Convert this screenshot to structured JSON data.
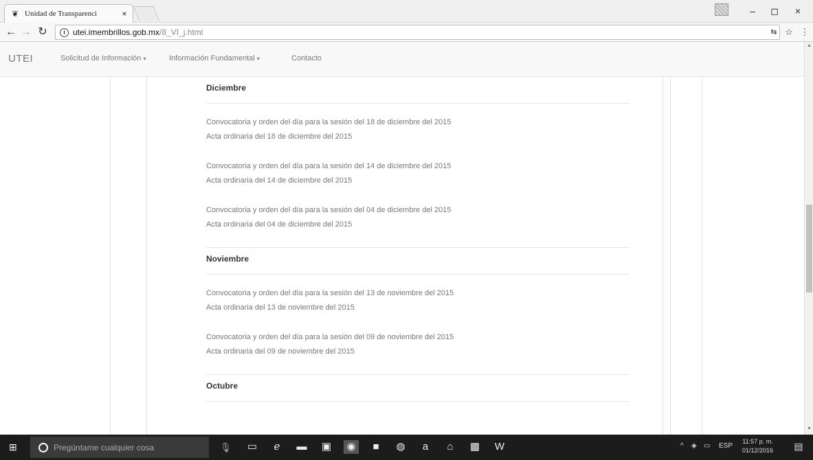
{
  "browser": {
    "tab_title": "Unidad de Transparenci",
    "tab_close": "×",
    "url_host": "utei.imembrillos.gob.mx",
    "url_path": "/8_VI_j.html",
    "window_min": "–",
    "window_max": "◻",
    "window_close": "×"
  },
  "navbar": {
    "brand": "UTEI",
    "links": [
      {
        "label": "Solicitud de Información",
        "has_caret": true
      },
      {
        "label": "Información Fundamental",
        "has_caret": true
      },
      {
        "label": "Contacto",
        "has_caret": false
      }
    ],
    "caret": "▾"
  },
  "sections": [
    {
      "month": "Diciembre",
      "entries": [
        {
          "convocatoria": "Convocatoria y orden del día para la sesión del 18 de diciembre del 2015",
          "acta": "Acta ordinaria del 18 de diciembre del 2015"
        },
        {
          "convocatoria": "Convocatoria y orden del día para la sesión del 14 de diciembre del 2015",
          "acta": "Acta ordinaria del 14 de diciembre del 2015"
        },
        {
          "convocatoria": "Convocatoria y orden del día para la sesión del 04 de diciembre del 2015",
          "acta": "Acta ordinaria del 04 de diciembre del 2015"
        }
      ]
    },
    {
      "month": "Noviembre",
      "entries": [
        {
          "convocatoria": "Convocatoria y orden del día para la sesión del 13 de noviembre del 2015",
          "acta": "Acta ordinaria del 13 de noviembre del 2015"
        },
        {
          "convocatoria": "Convocatoria y orden del día para la sesión del 09 de noviembre del 2015",
          "acta": "Acta ordinaria del 09 de noviembre del 2015"
        }
      ]
    },
    {
      "month": "Octubre",
      "entries": []
    }
  ],
  "taskbar": {
    "search_placeholder": "Pregúntame cualquier cosa",
    "language": "ESP",
    "time": "11:57 p. m.",
    "date": "01/12/2016"
  }
}
